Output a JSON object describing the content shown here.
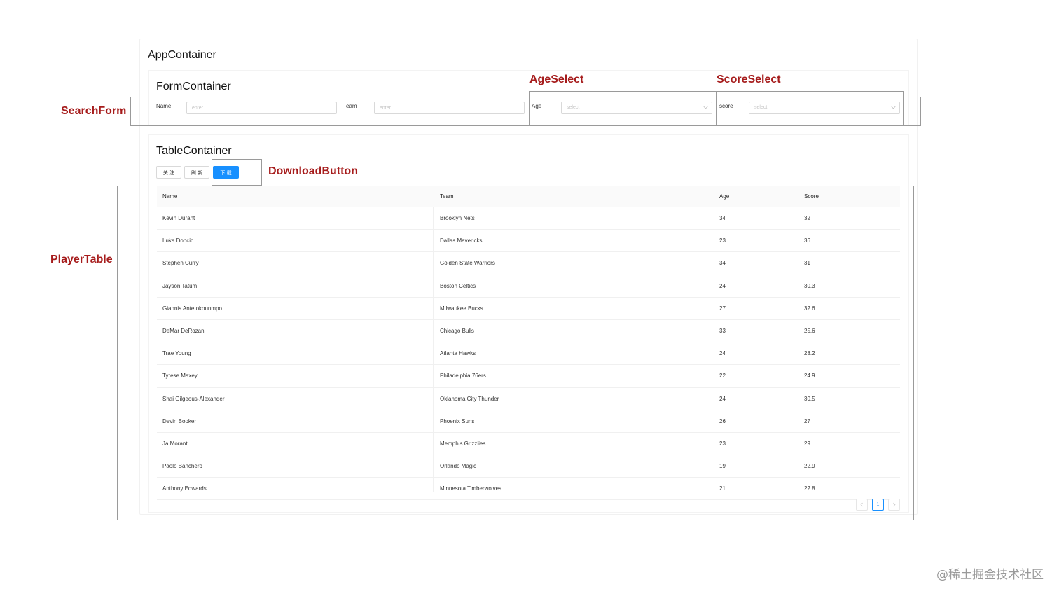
{
  "containers": {
    "app_title": "AppContainer",
    "form_title": "FormContainer",
    "table_title": "TableContainer"
  },
  "annotations": {
    "search_form": "SearchForm",
    "age_select": "AgeSelect",
    "score_select": "ScoreSelect",
    "download_button": "DownloadButton",
    "player_table": "PlayerTable",
    "label_color": "#a61c1c"
  },
  "form": {
    "name_label": "Name",
    "name_placeholder": "enter",
    "team_label": "Team",
    "team_placeholder": "enter",
    "age_label": "Age",
    "age_placeholder": "select",
    "score_label": "score",
    "score_placeholder": "select"
  },
  "toolbar": {
    "follow_label": "关 注",
    "refresh_label": "刷 新",
    "download_label": "下 载",
    "primary_color": "#1890ff"
  },
  "table": {
    "columns": [
      "Name",
      "Team",
      "Age",
      "Score"
    ],
    "rows": [
      [
        "Kevin Durant",
        "Brooklyn Nets",
        "34",
        "32"
      ],
      [
        "Luka Doncic",
        "Dallas Mavericks",
        "23",
        "36"
      ],
      [
        "Stephen Curry",
        "Golden State Warriors",
        "34",
        "31"
      ],
      [
        "Jayson Tatum",
        "Boston Celtics",
        "24",
        "30.3"
      ],
      [
        "Giannis Antetokounmpo",
        "Milwaukee Bucks",
        "27",
        "32.6"
      ],
      [
        "DeMar DeRozan",
        "Chicago Bulls",
        "33",
        "25.6"
      ],
      [
        "Trae Young",
        "Atlanta Hawks",
        "24",
        "28.2"
      ],
      [
        "Tyrese Maxey",
        "Philadelphia 76ers",
        "22",
        "24.9"
      ],
      [
        "Shai Gilgeous-Alexander",
        "Oklahoma City Thunder",
        "24",
        "30.5"
      ],
      [
        "Devin Booker",
        "Phoenix Suns",
        "26",
        "27"
      ],
      [
        "Ja Morant",
        "Memphis Grizzlies",
        "23",
        "29"
      ],
      [
        "Paolo Banchero",
        "Orlando Magic",
        "19",
        "22.9"
      ],
      [
        "Anthony Edwards",
        "Minnesota Timberwolves",
        "21",
        "22.8"
      ]
    ]
  },
  "pagination": {
    "prev_icon": "chevron-left-icon",
    "current_page": "1",
    "next_icon": "chevron-right-icon"
  },
  "watermark": "@稀土掘金技术社区"
}
